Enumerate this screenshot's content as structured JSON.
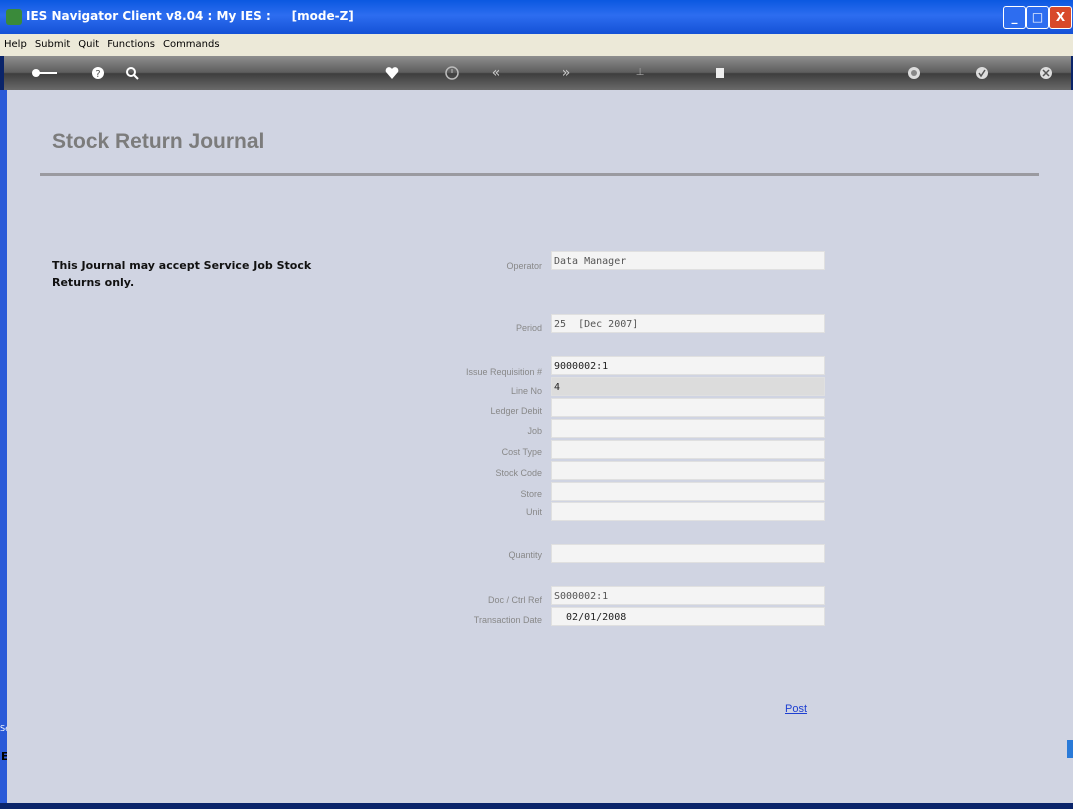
{
  "window": {
    "title": "IES Navigator Client v8.04 : My IES :     [mode-Z]",
    "controls": {
      "minimize": "_",
      "maximize": "□",
      "close": "X"
    }
  },
  "menu": [
    "Help",
    "Submit",
    "Quit",
    "Functions",
    "Commands"
  ],
  "toolbar_icons": [
    "key-icon",
    "help-icon",
    "search-icon",
    "heart-icon",
    "clock-icon",
    "rewind-icon",
    "forward-icon",
    "tree-icon",
    "stop-icon",
    "refresh-icon",
    "check-icon",
    "close-icon"
  ],
  "page": {
    "title": "Stock Return Journal",
    "note": "This Journal may accept Service Job Stock Returns only."
  },
  "fields": {
    "operator": {
      "label": "Operator",
      "value": "Data Manager"
    },
    "period": {
      "label": "Period",
      "value": "25  [Dec 2007]"
    },
    "issue_requisition": {
      "label": "Issue Requisition #",
      "value": "9000002:1"
    },
    "line_no": {
      "label": "Line No",
      "value": "4"
    },
    "ledger_debit": {
      "label": "Ledger Debit",
      "value": ""
    },
    "job": {
      "label": "Job",
      "value": ""
    },
    "cost_type": {
      "label": "Cost Type",
      "value": ""
    },
    "stock_code": {
      "label": "Stock Code",
      "value": ""
    },
    "store": {
      "label": "Store",
      "value": ""
    },
    "unit": {
      "label": "Unit",
      "value": ""
    },
    "quantity": {
      "label": "Quantity",
      "value": ""
    },
    "doc_ctrl_ref": {
      "label": "Doc / Ctrl Ref",
      "value": "S000002:1"
    },
    "transaction_date": {
      "label": "Transaction Date",
      "value": "  02/01/2008"
    }
  },
  "actions": {
    "post": "Post"
  },
  "side_panel": {
    "label": "Se",
    "label2": "E"
  }
}
